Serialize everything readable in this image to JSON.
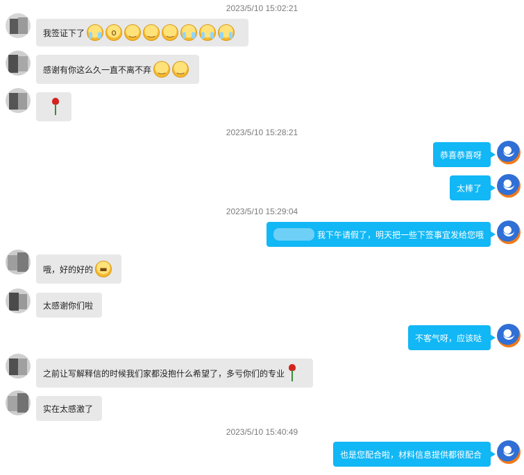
{
  "timestamps": {
    "t1": "2023/5/10 15:02:21",
    "t2": "2023/5/10 15:28:21",
    "t3": "2023/5/10 15:29:04",
    "t4": "2023/5/10 15:40:49"
  },
  "messages": {
    "m1": "我签证下了",
    "m2": "感谢有你这么久一直不离不弃",
    "m4": "恭喜恭喜呀",
    "m5": "太棒了",
    "m6": "我下午请假了，明天把一些下签事宜发给您哦",
    "m7": "哦，好的好的",
    "m8": "太感谢你们啦",
    "m9": "不客气呀，应该哒",
    "m10": "之前让写解释信的时候我们家都没抱什么希望了，多亏你们的专业",
    "m11": "实在太感激了",
    "m12": "也是您配合啦，材料信息提供都很配合"
  },
  "icons": {
    "rose": "rose-icon",
    "cry": "crying-emoji-icon",
    "smug": "smug-emoji-icon",
    "grin": "grin-emoji-icon"
  },
  "colors": {
    "incoming_bubble": "#e8e8e8",
    "outgoing_bubble": "#12b7f5",
    "timestamp": "#7a7a7a"
  }
}
